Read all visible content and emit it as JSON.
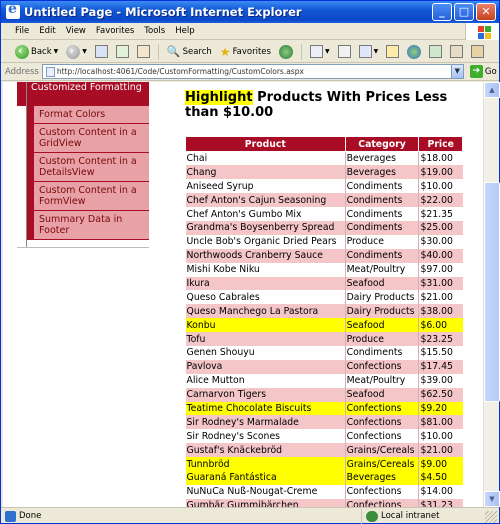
{
  "window": {
    "title": "Untitled Page - Microsoft Internet Explorer",
    "min_label": "_",
    "max_label": "□",
    "close_label": "✕"
  },
  "menu": {
    "items": [
      "File",
      "Edit",
      "View",
      "Favorites",
      "Tools",
      "Help"
    ]
  },
  "toolbar": {
    "back_label": "Back",
    "search_label": "Search",
    "favorites_label": "Favorites"
  },
  "address": {
    "label": "Address",
    "url": "http://localhost:4061/Code/CustomFormatting/CustomColors.aspx",
    "go_label": "Go"
  },
  "sidebar": {
    "header": "Customized Formatting",
    "items": [
      "Format Colors",
      "Custom Content in a GridView",
      "Custom Content in a DetailsView",
      "Custom Content in a FormView",
      "Summary Data in Footer"
    ]
  },
  "main": {
    "heading_highlight": "Highlight",
    "heading_rest": " Products With Prices Less than $10.00"
  },
  "table": {
    "headers": [
      "Product",
      "Category",
      "Price"
    ],
    "rows": [
      {
        "product": "Chai",
        "category": "Beverages",
        "price": "$18.00",
        "highlight": false
      },
      {
        "product": "Chang",
        "category": "Beverages",
        "price": "$19.00",
        "highlight": false
      },
      {
        "product": "Aniseed Syrup",
        "category": "Condiments",
        "price": "$10.00",
        "highlight": false
      },
      {
        "product": "Chef Anton's Cajun Seasoning",
        "category": "Condiments",
        "price": "$22.00",
        "highlight": false
      },
      {
        "product": "Chef Anton's Gumbo Mix",
        "category": "Condiments",
        "price": "$21.35",
        "highlight": false
      },
      {
        "product": "Grandma's Boysenberry Spread",
        "category": "Condiments",
        "price": "$25.00",
        "highlight": false
      },
      {
        "product": "Uncle Bob's Organic Dried Pears",
        "category": "Produce",
        "price": "$30.00",
        "highlight": false
      },
      {
        "product": "Northwoods Cranberry Sauce",
        "category": "Condiments",
        "price": "$40.00",
        "highlight": false
      },
      {
        "product": "Mishi Kobe Niku",
        "category": "Meat/Poultry",
        "price": "$97.00",
        "highlight": false
      },
      {
        "product": "Ikura",
        "category": "Seafood",
        "price": "$31.00",
        "highlight": false
      },
      {
        "product": "Queso Cabrales",
        "category": "Dairy Products",
        "price": "$21.00",
        "highlight": false
      },
      {
        "product": "Queso Manchego La Pastora",
        "category": "Dairy Products",
        "price": "$38.00",
        "highlight": false
      },
      {
        "product": "Konbu",
        "category": "Seafood",
        "price": "$6.00",
        "highlight": true
      },
      {
        "product": "Tofu",
        "category": "Produce",
        "price": "$23.25",
        "highlight": false
      },
      {
        "product": "Genen Shouyu",
        "category": "Condiments",
        "price": "$15.50",
        "highlight": false
      },
      {
        "product": "Pavlova",
        "category": "Confections",
        "price": "$17.45",
        "highlight": false
      },
      {
        "product": "Alice Mutton",
        "category": "Meat/Poultry",
        "price": "$39.00",
        "highlight": false
      },
      {
        "product": "Carnarvon Tigers",
        "category": "Seafood",
        "price": "$62.50",
        "highlight": false
      },
      {
        "product": "Teatime Chocolate Biscuits",
        "category": "Confections",
        "price": "$9.20",
        "highlight": true
      },
      {
        "product": "Sir Rodney's Marmalade",
        "category": "Confections",
        "price": "$81.00",
        "highlight": false
      },
      {
        "product": "Sir Rodney's Scones",
        "category": "Confections",
        "price": "$10.00",
        "highlight": false
      },
      {
        "product": "Gustaf's Knäckebröd",
        "category": "Grains/Cereals",
        "price": "$21.00",
        "highlight": false
      },
      {
        "product": "Tunnbröd",
        "category": "Grains/Cereals",
        "price": "$9.00",
        "highlight": true
      },
      {
        "product": "Guaraná Fantástica",
        "category": "Beverages",
        "price": "$4.50",
        "highlight": true
      },
      {
        "product": "NuNuCa Nuß-Nougat-Creme",
        "category": "Confections",
        "price": "$14.00",
        "highlight": false
      },
      {
        "product": "Gumbär Gummibärchen",
        "category": "Confections",
        "price": "$31.23",
        "highlight": false
      }
    ]
  },
  "status": {
    "left": "Done",
    "zone": "Local intranet"
  },
  "colors": {
    "accent": "#a80d25",
    "alt_row": "#f4c6c8",
    "highlight": "#ffff00"
  }
}
